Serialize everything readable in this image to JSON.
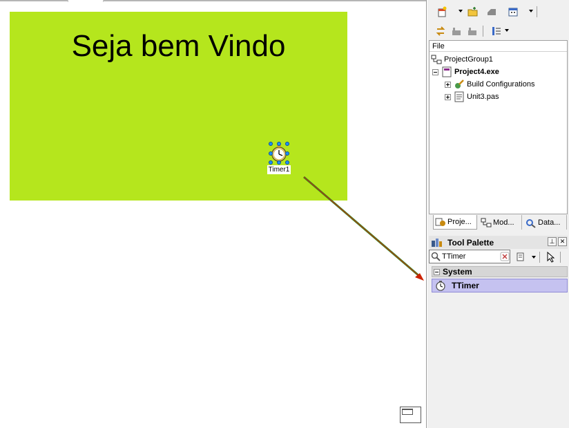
{
  "designer": {
    "form_title": "Seja bem Vindo",
    "form_color": "#b5e61d",
    "timer_caption": "Timer1"
  },
  "toolbar": {
    "icons": [
      "new-items-icon",
      "open-folder-icon",
      "options-icon",
      "calendar-icon",
      "sync-icon",
      "add-to-project-icon",
      "remove-from-project-icon",
      "list-view-icon"
    ]
  },
  "project_manager": {
    "header": "File",
    "items": [
      {
        "label": "ProjectGroup1",
        "bold": false
      },
      {
        "label": "Project4.exe",
        "bold": true
      },
      {
        "label": "Build Configurations",
        "bold": false
      },
      {
        "label": "Unit3.pas",
        "bold": false
      }
    ],
    "tabs": [
      {
        "label": "Proje...",
        "active": true
      },
      {
        "label": "Mod...",
        "active": false
      },
      {
        "label": "Data...",
        "active": false
      }
    ]
  },
  "tool_palette": {
    "title": "Tool Palette",
    "search_value": "TTimer",
    "category": "System",
    "selected_item": "TTimer",
    "selection_color": "#c5c2f0"
  },
  "annotation": {
    "arrow_color": "#3a8a2a",
    "arrow_head_color": "#cc2200"
  }
}
